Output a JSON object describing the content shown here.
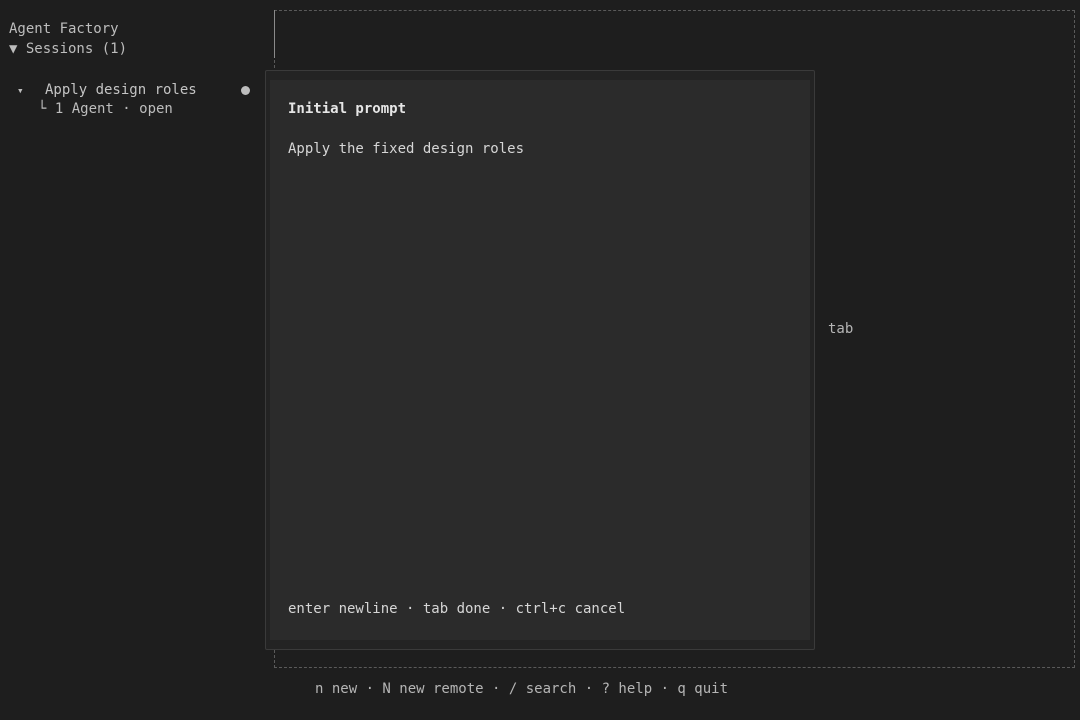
{
  "app": {
    "title": "Agent Factory"
  },
  "sidebar": {
    "sessions_header": "▼ Sessions (1)",
    "sessions": [
      {
        "caret": "▾",
        "title": "Apply design roles",
        "subtitle": "└ 1 Agent · open",
        "status_dot": "●"
      }
    ]
  },
  "modal": {
    "title": "Initial prompt",
    "prompt_text": "Apply the fixed design roles",
    "hints": "enter newline · tab done · ctrl+c cancel"
  },
  "side_label": "tab",
  "footer": {
    "hints": "n new · N new remote · / search · ? help · q quit"
  },
  "colors": {
    "background": "#1e1e1e",
    "modal_background": "#2b2b2b",
    "text": "#c8c8c8"
  }
}
